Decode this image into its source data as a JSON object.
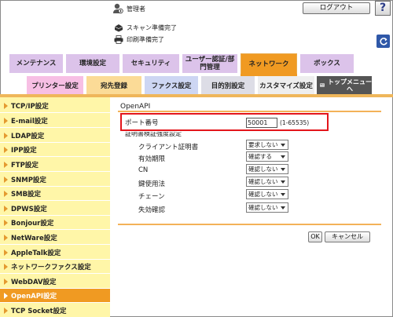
{
  "header": {
    "user": "管理者",
    "logout_label": "ログアウト",
    "help_label": "?",
    "scan_status": "スキャン準備完了",
    "print_status": "印刷準備完了"
  },
  "tabs_row1": [
    {
      "label": "メンテナンス",
      "color": "#dcc3ea"
    },
    {
      "label": "環境設定",
      "color": "#dcc3ea"
    },
    {
      "label": "セキュリティ",
      "color": "#dcc3ea"
    },
    {
      "label": "ユーザー認証/部\n門管理",
      "color": "#dcc3ea"
    },
    {
      "label": "ネットワーク",
      "color": "#f09a22",
      "active": true
    },
    {
      "label": "ボックス",
      "color": "#dcc3ea"
    }
  ],
  "tabs_row2": [
    {
      "label": "プリンター設定",
      "color": "#f7bfe4"
    },
    {
      "label": "宛先登録",
      "color": "#fbdb97"
    },
    {
      "label": "ファクス設定",
      "color": "#cdd6f3"
    },
    {
      "label": "目的別設定",
      "color": "#dddde6"
    },
    {
      "label": "カスタマイズ設定",
      "color": "#eeeeee"
    },
    {
      "label": "トップメニュー\nへ",
      "color": "#555555"
    }
  ],
  "sidebar": {
    "items": [
      {
        "label": "TCP/IP設定"
      },
      {
        "label": "E-mail設定"
      },
      {
        "label": "LDAP設定"
      },
      {
        "label": "IPP設定"
      },
      {
        "label": "FTP設定"
      },
      {
        "label": "SNMP設定"
      },
      {
        "label": "SMB設定"
      },
      {
        "label": "DPWS設定"
      },
      {
        "label": "Bonjour設定"
      },
      {
        "label": "NetWare設定"
      },
      {
        "label": "AppleTalk設定"
      },
      {
        "label": "ネットワークファクス設定"
      },
      {
        "label": "WebDAV設定"
      },
      {
        "label": "OpenAPI設定",
        "active": true
      },
      {
        "label": "TCP Socket設定"
      }
    ]
  },
  "main": {
    "title": "OpenAPI",
    "port_label": "ポート番号",
    "port_value": "50001",
    "port_range": "(1-65535)",
    "cert_section_label": "証明書検証強度設定",
    "settings": [
      {
        "label": "クライアント証明書",
        "value": "要求しない"
      },
      {
        "label": "有効期限",
        "value": "確認する"
      },
      {
        "label": "CN",
        "value": "確認しない"
      },
      {
        "label": "鍵使用法",
        "value": "確認しない"
      },
      {
        "label": "チェーン",
        "value": "確認しない"
      },
      {
        "label": "失効確認",
        "value": "確認しない"
      }
    ],
    "ok_label": "OK",
    "cancel_label": "キャンセル"
  },
  "colors": {
    "accent": "#f09a22",
    "sidebar_bg": "#fff6a8",
    "highlight": "#e3151b"
  }
}
